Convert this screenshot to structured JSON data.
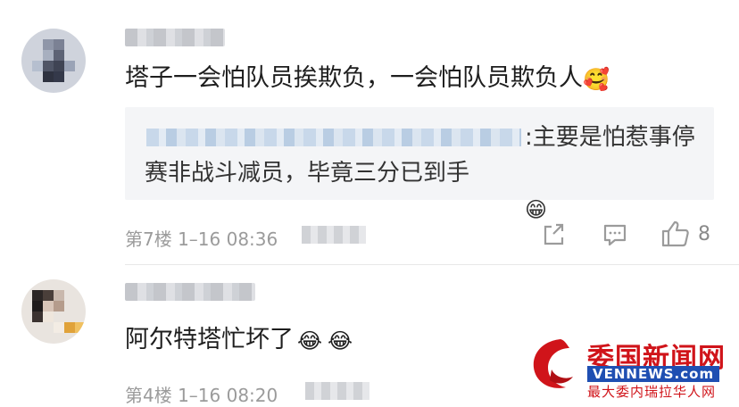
{
  "comments": [
    {
      "text": "塔子一会怕队员挨欺负，一会怕队员欺负人",
      "emojis": [
        "🥰"
      ],
      "quote": {
        "text": ":主要是怕惹事停赛非战斗减员，毕竟三分已到手",
        "emoji": "😁"
      },
      "meta": "第7楼 1–16 08:36",
      "like_count": "8"
    },
    {
      "text": "阿尔特塔忙坏了",
      "emojis": [
        "😂",
        "😂"
      ],
      "meta": "第4楼 1–16 08:20"
    }
  ],
  "icons": {
    "share": "share-icon",
    "reply": "comment-icon",
    "like": "thumbs-up-icon"
  },
  "watermark": {
    "title": "委国新闻网",
    "url": "VENNEWS.com",
    "subtitle": "最大委内瑞拉华人网"
  },
  "colors": {
    "meta_text": "#9b9b9b",
    "quote_bg": "#f4f5f7",
    "watermark_red": "#d0141a",
    "watermark_blue": "#1f4fb2"
  }
}
